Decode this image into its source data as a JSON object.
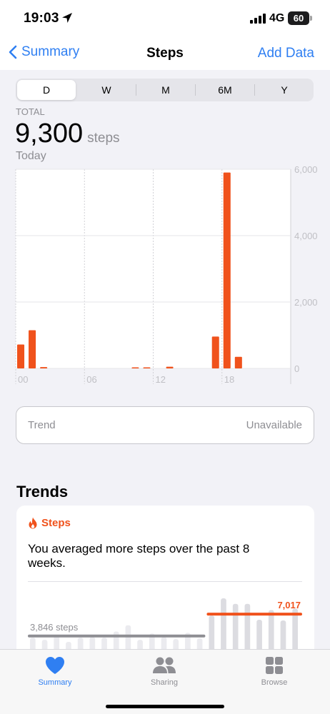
{
  "status_bar": {
    "time": "19:03",
    "network": "4G",
    "battery": "60"
  },
  "nav": {
    "back_label": "Summary",
    "title": "Steps",
    "action_label": "Add Data"
  },
  "segments": [
    {
      "label": "D",
      "active": true
    },
    {
      "label": "W"
    },
    {
      "label": "M"
    },
    {
      "label": "6M"
    },
    {
      "label": "Y"
    }
  ],
  "summary": {
    "label": "TOTAL",
    "value": "9,300",
    "unit": "steps",
    "date": "Today"
  },
  "chart_data": {
    "type": "bar",
    "x_tick_labels": [
      "00",
      "06",
      "12",
      "18"
    ],
    "y_tick_labels": [
      "6,000",
      "4,000",
      "2,000",
      "0"
    ],
    "ylim": [
      0,
      6000
    ],
    "x": [
      0,
      1,
      2,
      10,
      11,
      13,
      17,
      18,
      19
    ],
    "values": [
      720,
      1150,
      40,
      30,
      20,
      50,
      960,
      5900,
      350
    ],
    "color": "#f0521c"
  },
  "trend": {
    "label": "Trend",
    "value": "Unavailable"
  },
  "trends": {
    "section_title": "Trends",
    "card_title": "Steps",
    "message": "You averaged more steps over the past 8 weeks.",
    "old_avg_label": "3,846 steps",
    "new_avg_label": "7,017",
    "old_avg": 3846,
    "new_avg": 7017,
    "accent": "#f0521c",
    "chart_data": {
      "type": "bar",
      "values": [
        3600,
        3300,
        3900,
        3000,
        3600,
        3700,
        3600,
        4500,
        5400,
        3300,
        4200,
        3700,
        3400,
        4300,
        3500,
        6800,
        9300,
        8500,
        8500,
        6200,
        7600,
        6100,
        7800
      ]
    }
  },
  "tabbar": [
    {
      "label": "Summary",
      "icon": "heart-icon",
      "active": true
    },
    {
      "label": "Sharing",
      "icon": "people-icon"
    },
    {
      "label": "Browse",
      "icon": "grid-icon"
    }
  ]
}
